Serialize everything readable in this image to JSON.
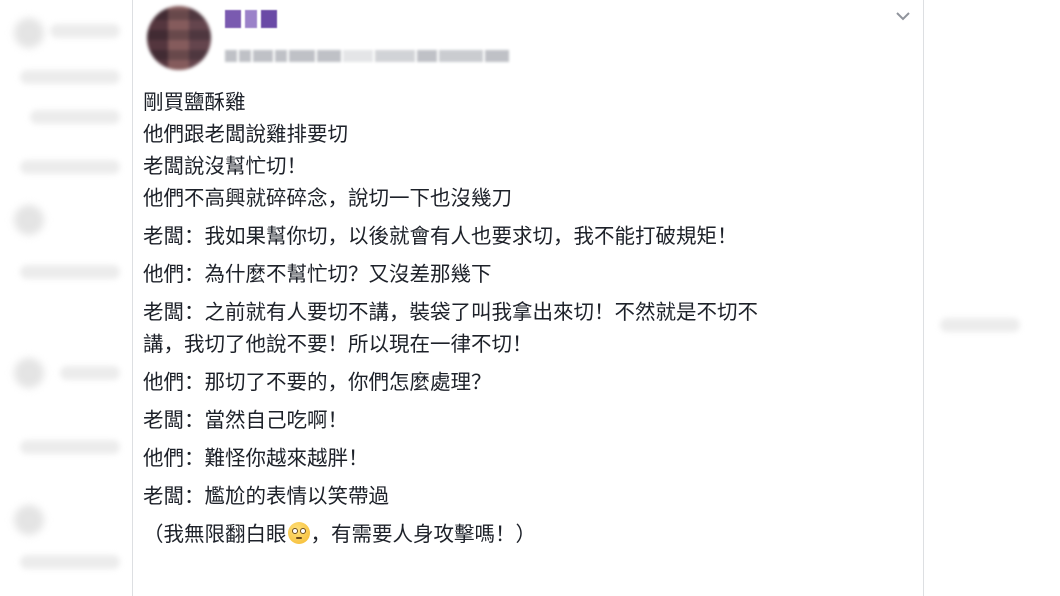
{
  "post": {
    "lines": [
      "剛買鹽酥雞",
      "他們跟老闆說雞排要切",
      "老闆說沒幫忙切！",
      "他們不高興就碎碎念，說切一下也沒幾刀",
      "老闆：我如果幫你切，以後就會有人也要求切，我不能打破規矩！",
      "他們：為什麼不幫忙切？又沒差那幾下",
      "老闆：之前就有人要切不講，裝袋了叫我拿出來切！不然就是不切不",
      "講，我切了他說不要！所以現在一律不切！",
      "他們：那切了不要的，你們怎麼處理？",
      "老闆：當然自己吃啊！",
      "他們：難怪你越來越胖！",
      "老闆：尷尬的表情以笑帶過"
    ],
    "last_line_before": "（我無限翻白眼",
    "last_line_after": "，有需要人身攻擊嗎！）"
  },
  "icons": {
    "chevron": "chevron-down-icon",
    "emoji": "eye-roll-emoji-icon"
  },
  "colors": {
    "text": "#1d2129",
    "border": "#dddfe2",
    "meta": "#b4b7bd"
  }
}
